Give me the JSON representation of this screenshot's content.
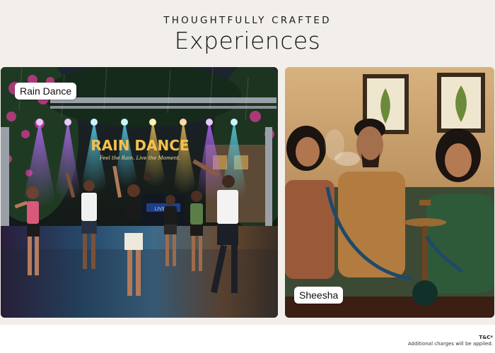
{
  "header": {
    "kicker": "THOUGHTFULLY CRAFTED",
    "title": "Experiences"
  },
  "cards": [
    {
      "label": "Rain Dance",
      "scene_sign": "RAIN DANCE",
      "scene_tagline": "Feel the Rain. Live the Moment.",
      "scene_screen": "LIVE DJ"
    },
    {
      "label": "Sheesha"
    }
  ],
  "footer": {
    "tc_title": "T&C*",
    "tc_note": "Additional charges will be applied."
  },
  "colors": {
    "page_bg": "#f2efeb",
    "tag_bg": "#ffffff",
    "sign_glow": "#f6c04a"
  }
}
